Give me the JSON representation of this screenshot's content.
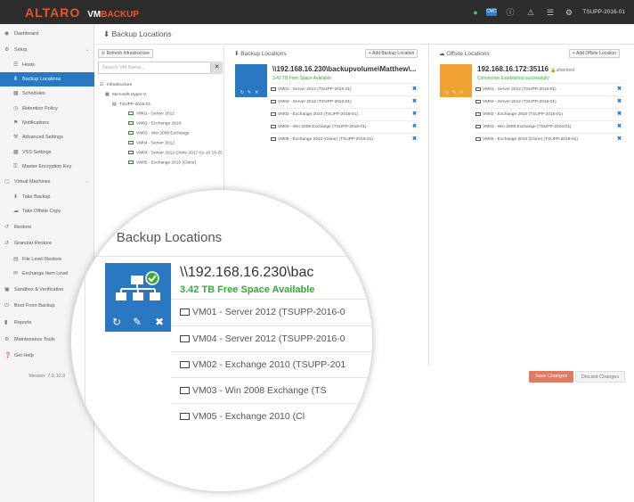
{
  "app": {
    "logo_text": "ALTARO",
    "logo_sub_vm": "VM",
    "logo_sub": "BACKUP",
    "host": "TSUPP-2016-01",
    "cmc_label": "CMC"
  },
  "sidebar": {
    "items": [
      {
        "label": "Dashboard",
        "icon": "dashboard-icon"
      },
      {
        "label": "Setup",
        "icon": "gear-icon"
      },
      {
        "label": "Hosts",
        "icon": "list-icon"
      },
      {
        "label": "Backup Locations",
        "icon": "download-icon"
      },
      {
        "label": "Schedules",
        "icon": "calendar-icon"
      },
      {
        "label": "Retention Policy",
        "icon": "clock-icon"
      },
      {
        "label": "Notifications",
        "icon": "bell-icon"
      },
      {
        "label": "Advanced Settings",
        "icon": "wrench-icon"
      },
      {
        "label": "VSS Settings",
        "icon": "screen-icon"
      },
      {
        "label": "Master Encryption Key",
        "icon": "key-icon"
      },
      {
        "label": "Virtual Machines",
        "icon": "monitor-icon"
      },
      {
        "label": "Take Backup",
        "icon": "download-icon"
      },
      {
        "label": "Take Offsite Copy",
        "icon": "cloud-icon"
      },
      {
        "label": "Restore",
        "icon": "restore-icon"
      },
      {
        "label": "Granular Restore",
        "icon": "restore-icon"
      },
      {
        "label": "File Level Restore",
        "icon": "file-icon"
      },
      {
        "label": "Exchange Item Level",
        "icon": "mail-icon"
      },
      {
        "label": "Sandbox & Verification",
        "icon": "box-icon"
      },
      {
        "label": "Boot From Backup",
        "icon": "power-icon"
      },
      {
        "label": "Reports",
        "icon": "chart-icon"
      },
      {
        "label": "Maintenance Tools",
        "icon": "gear-icon"
      },
      {
        "label": "Get Help",
        "icon": "help-icon"
      }
    ],
    "version": "Version: 7.0.12.0"
  },
  "page": {
    "title": "Backup Locations"
  },
  "tree": {
    "refresh_label": "Refresh Infrastructure",
    "search_placeholder": "Search VM Name...",
    "nodes": [
      "Infrastructure",
      "Microsoft Hyper-V",
      "TSUPP-2016-01",
      "VM01 - Server 2012",
      "VM02 - Exchange 2010",
      "VM03 - Win 2008 Exchange",
      "VM04 - Server 2012",
      "VM04 - Server 2012-Clone-2017-01-10 16-25",
      "VM05 - Exchange 2010 (Clone)"
    ]
  },
  "backup": {
    "header": "Backup Locations",
    "add_label": "Add Backup Location",
    "title": "\\\\192.168.16.230\\backupvolume\\Matthew\\...",
    "status": "3.42 TB Free Space Available",
    "vms": [
      "VM01 - Server 2012 (TSUPP-2016-01)",
      "VM04 - Server 2012 (TSUPP-2016-01)",
      "VM02 - Exchange 2010 (TSUPP-2016-01)",
      "VM03 - Win 2008 Exchange (TSUPP-2016-01)",
      "VM05 - Exchange 2010 (Clone) (TSUPP-2016-01)"
    ]
  },
  "offsite": {
    "header": "Offsite Locations",
    "add_label": "Add Offsite Location",
    "title": "192.168.16.172:35116",
    "user": "altarotest",
    "status": "Connection Established successfully",
    "vms": [
      "VM01 - Server 2012 (TSUPP-2016-01)",
      "VM04 - Server 2012 (TSUPP-2016-01)",
      "VM02 - Exchange 2010 (TSUPP-2016-01)",
      "VM03 - Win 2008 Exchange (TSUPP-2016-01)",
      "VM05 - Exchange 2010 (Clone) (TSUPP-2016-01)"
    ]
  },
  "actions": {
    "save": "Save Changes",
    "discard": "Discard Changes"
  },
  "magnifier": {
    "heading": "Backup Locations",
    "title": "\\\\192.168.16.230\\bac",
    "status": "3.42 TB Free Space Available",
    "rows": [
      "VM01 - Server 2012 (TSUPP-2016-0",
      "VM04 - Server 2012 (TSUPP-2016-0",
      "VM02 - Exchange 2010 (TSUPP-201",
      "VM03 - Win 2008 Exchange (TS",
      "VM05 - Exchange 2010 (Cl"
    ]
  },
  "colors": {
    "accent": "#2b78c2",
    "brand": "#e05a2b",
    "offsite_tile": "#f0a233",
    "success": "#3aa83a",
    "save": "#e07b63"
  }
}
